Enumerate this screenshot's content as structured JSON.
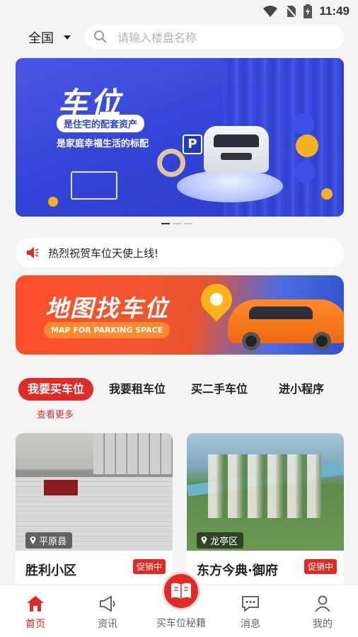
{
  "status_bar": {
    "time": "11:49"
  },
  "search": {
    "region": "全国",
    "placeholder": "请输入楼盘名称"
  },
  "banner": {
    "headline": "车位",
    "tagline_pill": "是住宅的配套资产",
    "tagline": "是家庭幸福生活的标配",
    "sign_letter": "P",
    "page_count": 3,
    "active_page": 1
  },
  "notice": {
    "text": "热烈祝贺车位天使上线!"
  },
  "map_banner": {
    "title": "地图找车位",
    "subtitle": "MAP FOR PARKING SPACE"
  },
  "tabs": [
    {
      "label": "我要买车位",
      "active": true
    },
    {
      "label": "我要租车位",
      "active": false
    },
    {
      "label": "买二手车位",
      "active": false
    },
    {
      "label": "进小程序",
      "active": false
    }
  ],
  "more_link": "查看更多",
  "listings": [
    {
      "name": "胜利小区",
      "location": "平原县",
      "badge": "促销中"
    },
    {
      "name": "东方今典·御府",
      "location": "龙亭区",
      "badge": "促销中"
    }
  ],
  "tabbar": {
    "home": "首页",
    "news": "资讯",
    "center": "买车位秘籍",
    "messages": "消息",
    "mine": "我的"
  },
  "colors": {
    "accent": "#e02a26",
    "banner_blue": "#3446d8",
    "map_orange": "#ff4e2b"
  },
  "icons": [
    "wifi-icon",
    "no-sim-icon",
    "battery-icon",
    "search-icon",
    "speaker-icon",
    "home-icon",
    "megaphone-icon",
    "book-icon",
    "message-icon",
    "person-icon",
    "location-pin-icon"
  ]
}
